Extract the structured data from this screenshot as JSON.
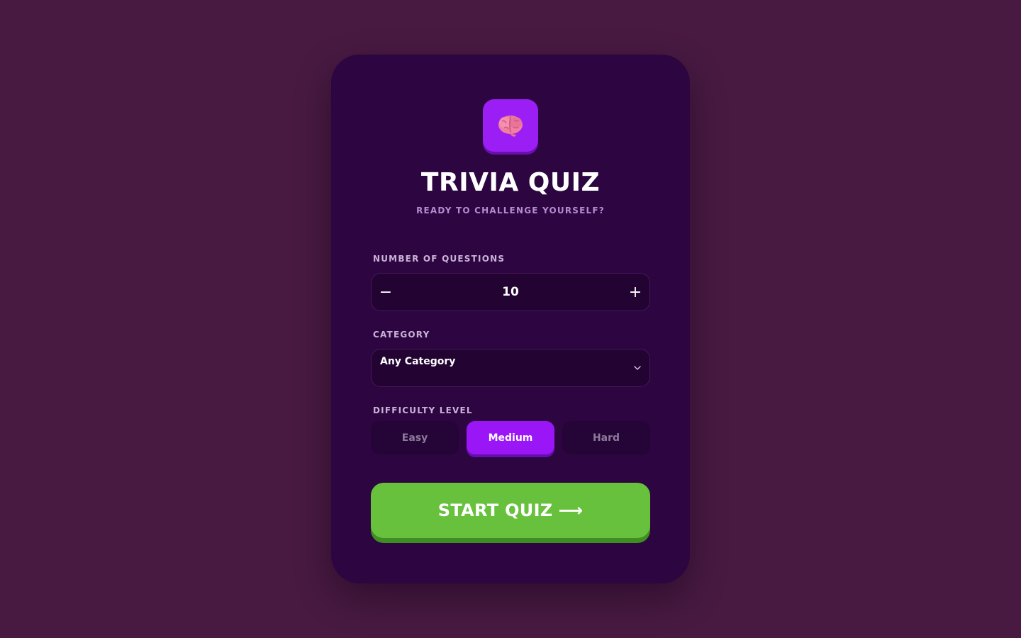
{
  "quiz": {
    "title": "TRIVIA QUIZ",
    "subtitle": "READY TO CHALLENGE YOURSELF?",
    "logo_icon": "brain-icon"
  },
  "questions": {
    "label": "NUMBER OF QUESTIONS",
    "decrement_symbol": "−",
    "value": "10",
    "increment_symbol": "+"
  },
  "category": {
    "label": "CATEGORY",
    "selected": "Any Category"
  },
  "difficulty": {
    "label": "DIFFICULTY LEVEL",
    "options": [
      "Easy",
      "Medium",
      "Hard"
    ],
    "selected": "Medium"
  },
  "start": {
    "label": "START QUIZ",
    "arrow": "⟶"
  },
  "colors": {
    "background": "#481a42",
    "card": "#2d0540",
    "accent": "#9b16f7",
    "start_button": "#68c13d"
  }
}
